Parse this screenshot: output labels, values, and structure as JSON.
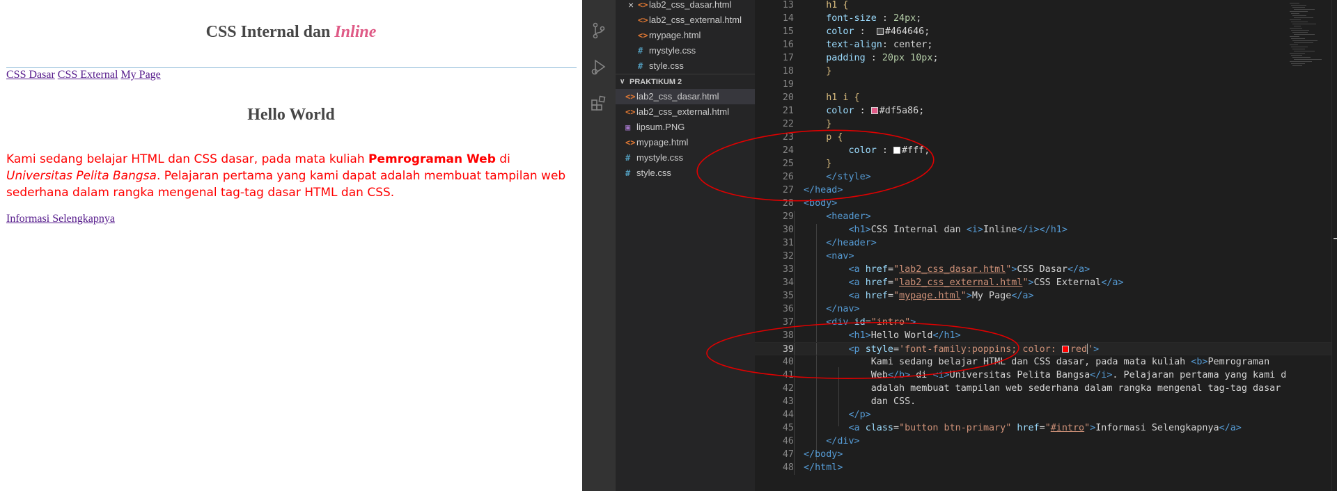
{
  "preview": {
    "title_plain": "CSS Internal dan ",
    "title_italic": "Inline",
    "nav": [
      "CSS Dasar",
      "CSS External",
      "My Page"
    ],
    "hello": "Hello World",
    "para": {
      "t1": "Kami sedang belajar HTML dan CSS dasar, pada mata kuliah ",
      "bold": "Pemrograman Web",
      "t2": " di ",
      "italic": "Universitas Pelita Bangsa",
      "t3": ". Pelajaran pertama yang kami dapat adalah membuat tampilan web sederhana dalam rangka mengenal tag-tag dasar HTML dan CSS."
    },
    "more_link": "Informasi Selengkapnya"
  },
  "explorer": {
    "open_editors": [
      {
        "icon": "<>",
        "kind": "html",
        "label": "lab2_css_dasar.html",
        "closable": true
      },
      {
        "icon": "<>",
        "kind": "html",
        "label": "lab2_css_external.html"
      },
      {
        "icon": "<>",
        "kind": "html",
        "label": "mypage.html"
      },
      {
        "icon": "#",
        "kind": "css",
        "label": "mystyle.css"
      },
      {
        "icon": "#",
        "kind": "css",
        "label": "style.css"
      }
    ],
    "close_glyph": "×",
    "section_chevron": "∨",
    "section": "PRAKTIKUM 2",
    "files": [
      {
        "icon": "<>",
        "kind": "html",
        "label": "lab2_css_dasar.html",
        "active": true
      },
      {
        "icon": "<>",
        "kind": "html",
        "label": "lab2_css_external.html"
      },
      {
        "icon": "▣",
        "kind": "png",
        "label": "lipsum.PNG"
      },
      {
        "icon": "<>",
        "kind": "html",
        "label": "mypage.html"
      },
      {
        "icon": "#",
        "kind": "css",
        "label": "mystyle.css"
      },
      {
        "icon": "#",
        "kind": "css",
        "label": "style.css"
      }
    ]
  },
  "activity_icons": [
    "files-icon",
    "source-control-icon",
    "run-debug-icon",
    "extensions-icon"
  ],
  "editor": {
    "lines": [
      {
        "n": "13",
        "s": [
          [
            "    ",
            ""
          ],
          [
            "h1 {",
            "sl"
          ]
        ]
      },
      {
        "n": "14",
        "s": [
          [
            "    ",
            ""
          ],
          [
            "font-size",
            "pr"
          ],
          [
            " : ",
            ""
          ],
          [
            "24px",
            "nm"
          ],
          [
            ";",
            ""
          ]
        ]
      },
      {
        "n": "15",
        "s": [
          [
            "    ",
            ""
          ],
          [
            "color",
            "pr"
          ],
          [
            " :  ",
            ""
          ],
          [
            "#464646",
            "sw"
          ],
          [
            "#464646",
            ""
          ],
          [
            ";",
            ""
          ]
        ]
      },
      {
        "n": "16",
        "s": [
          [
            "    ",
            ""
          ],
          [
            "text-align",
            "pr"
          ],
          [
            ": center;",
            ""
          ]
        ]
      },
      {
        "n": "17",
        "s": [
          [
            "    ",
            ""
          ],
          [
            "padding",
            "pr"
          ],
          [
            " : ",
            ""
          ],
          [
            "20px 10px",
            "nm"
          ],
          [
            ";",
            ""
          ]
        ]
      },
      {
        "n": "18",
        "s": [
          [
            "    ",
            ""
          ],
          [
            "}",
            "sl"
          ]
        ]
      },
      {
        "n": "19",
        "s": []
      },
      {
        "n": "20",
        "s": [
          [
            "    ",
            ""
          ],
          [
            "h1 i {",
            "sl"
          ]
        ]
      },
      {
        "n": "21",
        "s": [
          [
            "    ",
            ""
          ],
          [
            "color",
            "pr"
          ],
          [
            " : ",
            ""
          ],
          [
            "#df5a86",
            "sw"
          ],
          [
            "#df5a86",
            ""
          ],
          [
            ";",
            ""
          ]
        ]
      },
      {
        "n": "22",
        "s": [
          [
            "    ",
            ""
          ],
          [
            "}",
            "sl"
          ]
        ]
      },
      {
        "n": "23",
        "s": [
          [
            "    ",
            ""
          ],
          [
            "p {",
            "sl"
          ]
        ]
      },
      {
        "n": "24",
        "s": [
          [
            "        ",
            ""
          ],
          [
            "color",
            "pr"
          ],
          [
            " : ",
            ""
          ],
          [
            "#ffffff",
            "sw"
          ],
          [
            "#fff",
            ""
          ],
          [
            ";",
            ""
          ]
        ]
      },
      {
        "n": "25",
        "s": [
          [
            "    ",
            ""
          ],
          [
            "}",
            "sl"
          ]
        ]
      },
      {
        "n": "26",
        "s": [
          [
            "    ",
            ""
          ],
          [
            "</style>",
            "tg"
          ]
        ]
      },
      {
        "n": "27",
        "s": [
          [
            "</head>",
            "tg"
          ]
        ]
      },
      {
        "n": "28",
        "s": [
          [
            "<body>",
            "tg"
          ]
        ]
      },
      {
        "n": "29",
        "s": [
          [
            "    ",
            ""
          ],
          [
            "<header>",
            "tg"
          ]
        ]
      },
      {
        "n": "30",
        "s": [
          [
            "        ",
            ""
          ],
          [
            "<h1>",
            "tg"
          ],
          [
            "CSS Internal dan ",
            ""
          ],
          [
            "<i>",
            "tg"
          ],
          [
            "Inline",
            ""
          ],
          [
            "</i></h1>",
            "tg"
          ]
        ]
      },
      {
        "n": "31",
        "s": [
          [
            "    ",
            ""
          ],
          [
            "</header>",
            "tg"
          ]
        ]
      },
      {
        "n": "32",
        "s": [
          [
            "    ",
            ""
          ],
          [
            "<nav>",
            "tg"
          ]
        ]
      },
      {
        "n": "33",
        "s": [
          [
            "        ",
            ""
          ],
          [
            "<a ",
            "tg"
          ],
          [
            "href",
            "at"
          ],
          [
            "=",
            ""
          ],
          [
            "\"",
            "st"
          ],
          [
            "lab2_css_dasar.html",
            "stul"
          ],
          [
            "\"",
            "st"
          ],
          [
            ">",
            "tg"
          ],
          [
            "CSS Dasar",
            ""
          ],
          [
            "</a>",
            "tg"
          ]
        ]
      },
      {
        "n": "34",
        "s": [
          [
            "        ",
            ""
          ],
          [
            "<a ",
            "tg"
          ],
          [
            "href",
            "at"
          ],
          [
            "=",
            ""
          ],
          [
            "\"",
            "st"
          ],
          [
            "lab2_css_external.html",
            "stul"
          ],
          [
            "\"",
            "st"
          ],
          [
            ">",
            "tg"
          ],
          [
            "CSS External",
            ""
          ],
          [
            "</a>",
            "tg"
          ]
        ]
      },
      {
        "n": "35",
        "s": [
          [
            "        ",
            ""
          ],
          [
            "<a ",
            "tg"
          ],
          [
            "href",
            "at"
          ],
          [
            "=",
            ""
          ],
          [
            "\"",
            "st"
          ],
          [
            "mypage.html",
            "stul"
          ],
          [
            "\"",
            "st"
          ],
          [
            ">",
            "tg"
          ],
          [
            "My Page",
            ""
          ],
          [
            "</a>",
            "tg"
          ]
        ]
      },
      {
        "n": "36",
        "s": [
          [
            "    ",
            ""
          ],
          [
            "</nav>",
            "tg"
          ]
        ]
      },
      {
        "n": "37",
        "s": [
          [
            "    ",
            ""
          ],
          [
            "<div ",
            "tg"
          ],
          [
            "id",
            "at"
          ],
          [
            "=",
            ""
          ],
          [
            "\"intro\"",
            "st"
          ],
          [
            ">",
            "tg"
          ]
        ]
      },
      {
        "n": "38",
        "s": [
          [
            "        ",
            ""
          ],
          [
            "<h1>",
            "tg"
          ],
          [
            "Hello World",
            ""
          ],
          [
            "</h1>",
            "tg"
          ]
        ]
      },
      {
        "n": "39",
        "cur": true,
        "s": [
          [
            "        ",
            ""
          ],
          [
            "<p ",
            "tg"
          ],
          [
            "style",
            "at"
          ],
          [
            "=",
            ""
          ],
          [
            "'font-family:poppins; color: ",
            "st"
          ],
          [
            "#ff0000",
            "sw"
          ],
          [
            "red",
            "st"
          ],
          [
            "",
            "caret"
          ],
          [
            "'",
            "st"
          ],
          [
            ">",
            "tg"
          ]
        ]
      },
      {
        "n": "40",
        "s": [
          [
            "            Kami sedang belajar HTML dan CSS dasar, pada mata kuliah ",
            ""
          ],
          [
            "<b>",
            "tg"
          ],
          [
            "Pemrograman",
            ""
          ]
        ]
      },
      {
        "n": "41",
        "s": [
          [
            "            Web",
            ""
          ],
          [
            "</b>",
            "tg"
          ],
          [
            " di ",
            ""
          ],
          [
            "<i>",
            "tg"
          ],
          [
            "Universitas Pelita Bangsa",
            ""
          ],
          [
            "</i>",
            "tg"
          ],
          [
            ". Pelajaran pertama yang kami d",
            ""
          ]
        ]
      },
      {
        "n": "42",
        "s": [
          [
            "            adalah membuat tampilan web sederhana dalam rangka mengenal tag-tag dasar",
            ""
          ]
        ]
      },
      {
        "n": "43",
        "s": [
          [
            "            dan CSS.",
            ""
          ]
        ]
      },
      {
        "n": "44",
        "s": [
          [
            "        ",
            ""
          ],
          [
            "</p>",
            "tg"
          ]
        ]
      },
      {
        "n": "45",
        "s": [
          [
            "        ",
            ""
          ],
          [
            "<a ",
            "tg"
          ],
          [
            "class",
            "at"
          ],
          [
            "=",
            ""
          ],
          [
            "\"button btn-primary\"",
            "st"
          ],
          [
            " ",
            ""
          ],
          [
            "href",
            "at"
          ],
          [
            "=",
            ""
          ],
          [
            "\"",
            "st"
          ],
          [
            "#intro",
            "stul"
          ],
          [
            "\"",
            "st"
          ],
          [
            ">",
            "tg"
          ],
          [
            "Informasi Selengkapnya",
            ""
          ],
          [
            "</a>",
            "tg"
          ]
        ]
      },
      {
        "n": "46",
        "s": [
          [
            "    ",
            ""
          ],
          [
            "</div>",
            "tg"
          ]
        ]
      },
      {
        "n": "47",
        "s": [
          [
            "</body>",
            "tg"
          ]
        ]
      },
      {
        "n": "48",
        "s": [
          [
            "</html>",
            "tg"
          ]
        ]
      }
    ]
  },
  "colors": {
    "annotation": "#e00000",
    "accent_pink": "#df5a86",
    "heading": "#464646"
  }
}
